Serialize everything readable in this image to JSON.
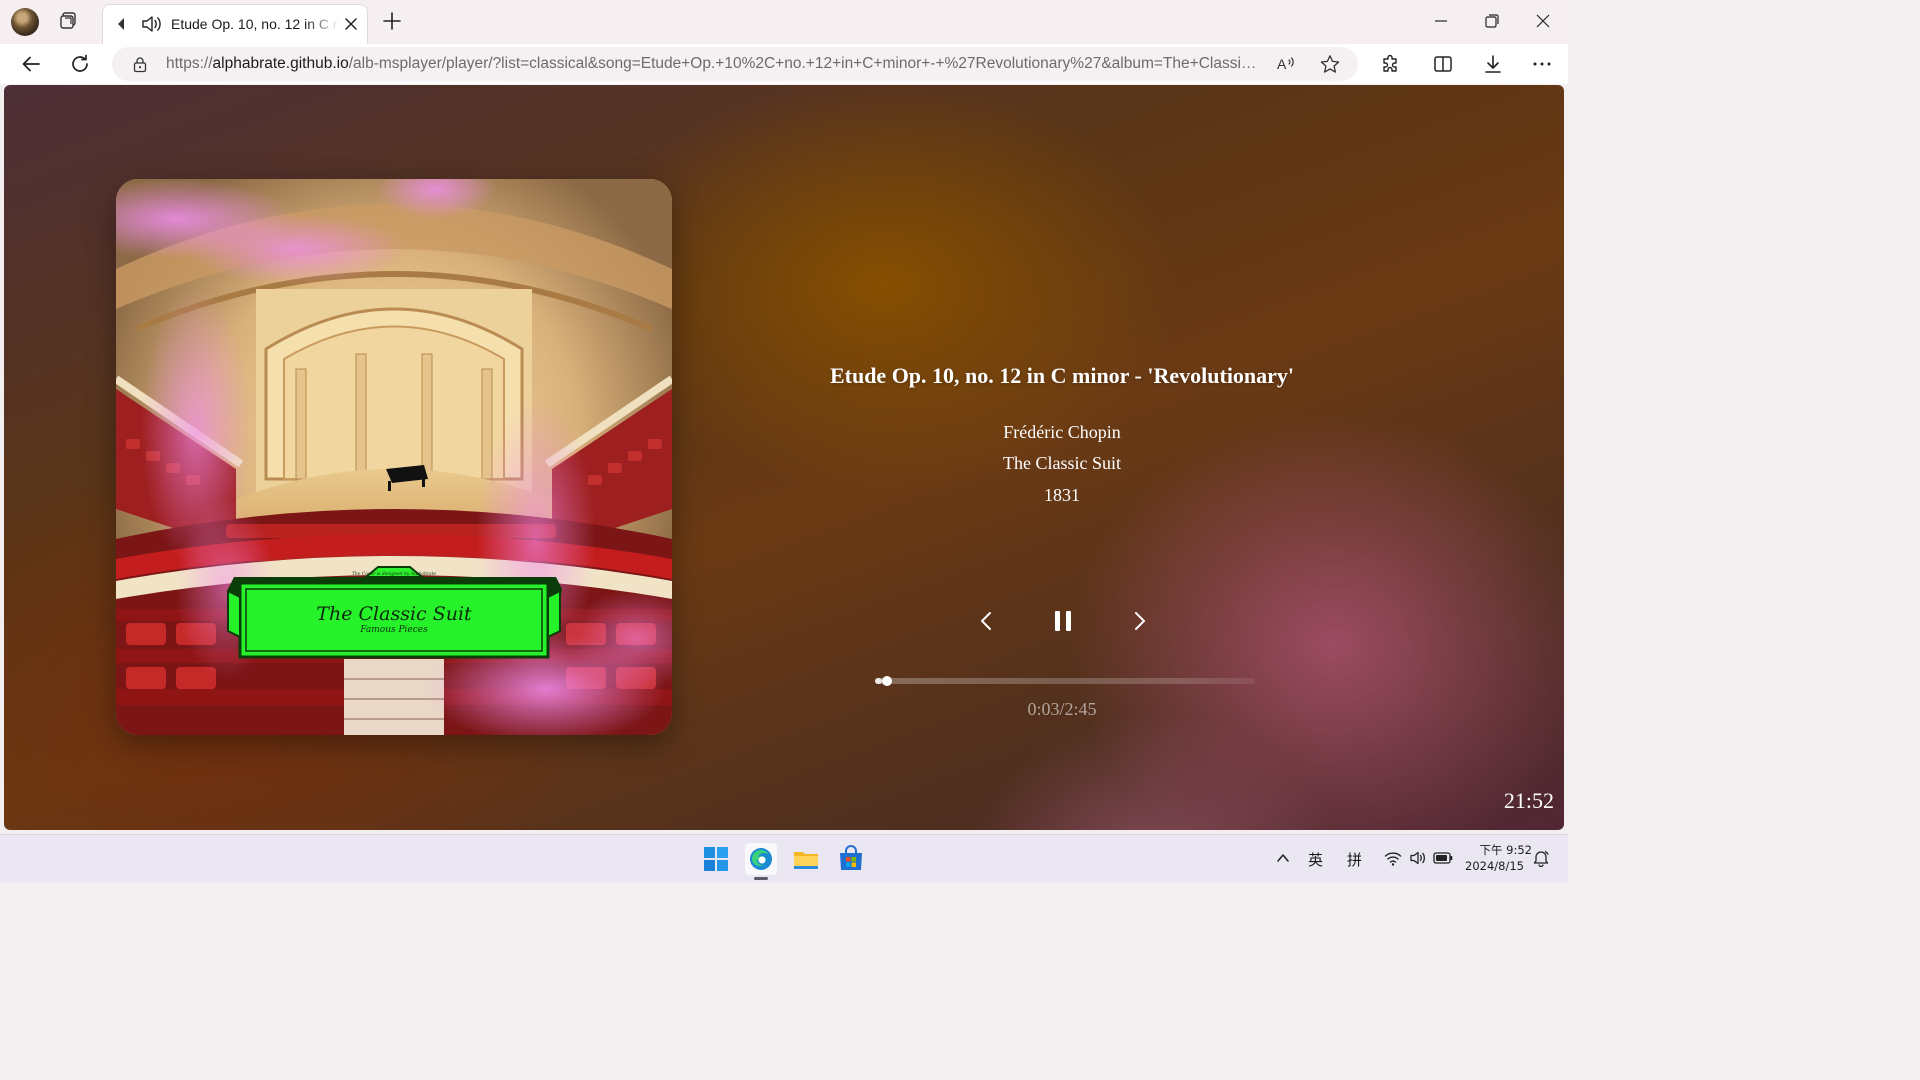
{
  "browser": {
    "tab": {
      "title": "Etude Op. 10, no. 12 in C minor - 'Revolutionary'"
    },
    "address": {
      "scheme": "https://",
      "host": "alphabrate.github.io",
      "path": "/alb-msplayer/player/?list=classical&song=Etude+Op.+10%2C+no.+12+in+C+minor+-+%27Revolutionary%27&album=The+Classic+Suit"
    },
    "icons": {
      "profile": "profile-avatar",
      "workspaces": "workspaces-icon",
      "tab_back": "chevron-left-icon",
      "tab_audio": "speaker-icon",
      "tab_close": "close-icon",
      "new_tab": "plus-icon",
      "back": "arrow-left-icon",
      "reload": "reload-icon",
      "lock": "lock-icon",
      "read_aloud": "read-aloud-icon",
      "favorite": "star-icon",
      "extensions": "puzzle-icon",
      "split": "split-screen-icon",
      "downloads": "download-icon",
      "more": "more-icon"
    }
  },
  "player": {
    "album_art": {
      "label_top": "The Cover is designed by Alphabrate",
      "label_main": "The Classic Suit",
      "label_sub": "Famous Pieces"
    },
    "song": {
      "title": "Etude Op. 10, no. 12 in C minor - 'Revolutionary'",
      "artist": "Frédéric Chopin",
      "album": "The Classic Suit",
      "year": "1831"
    },
    "controls": {
      "prev": "chevron-left-icon",
      "pause": "pause-icon",
      "next": "chevron-right-icon"
    },
    "progress": {
      "elapsed_seconds": 3,
      "total_seconds": 165,
      "time_text": "0:03/2:45"
    },
    "clock": "21:52",
    "colors": {
      "text": "#ffffff",
      "accent_brown": "#885000",
      "accent_pink": "#aa506e",
      "label_green": "#22ff22"
    }
  },
  "taskbar": {
    "apps": [
      "windows-start-icon",
      "edge-icon",
      "file-explorer-icon",
      "microsoft-store-icon"
    ],
    "tray": {
      "lang": "英",
      "ime": "拼",
      "time": "下午 9:52",
      "date": "2024/8/15"
    }
  }
}
